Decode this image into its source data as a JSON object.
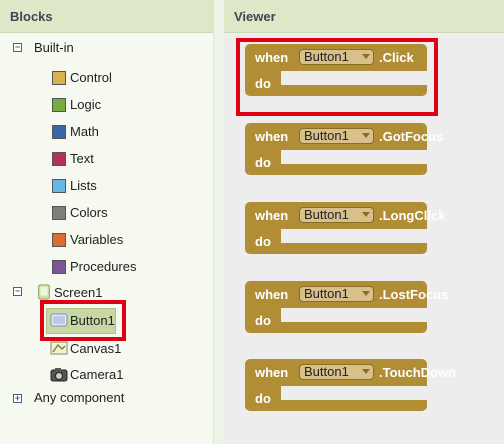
{
  "blocks_panel": {
    "title": "Blocks"
  },
  "viewer_panel": {
    "title": "Viewer"
  },
  "tree": {
    "builtin": {
      "label": "Built-in",
      "expander": "⊟",
      "items": [
        {
          "label": "Control",
          "color": "#d9b34a"
        },
        {
          "label": "Logic",
          "color": "#77ab41"
        },
        {
          "label": "Math",
          "color": "#3a67a8"
        },
        {
          "label": "Text",
          "color": "#b8305a"
        },
        {
          "label": "Lists",
          "color": "#67b7e3"
        },
        {
          "label": "Colors",
          "color": "#7d7d7d"
        },
        {
          "label": "Variables",
          "color": "#e06a2e"
        },
        {
          "label": "Procedures",
          "color": "#7b5595"
        }
      ]
    },
    "screen": {
      "label": "Screen1",
      "expander": "⊟"
    },
    "components": [
      {
        "label": "Button1",
        "icon": "button-icon"
      },
      {
        "label": "Canvas1",
        "icon": "canvas-icon"
      },
      {
        "label": "Camera1",
        "icon": "camera-icon"
      }
    ],
    "any_component": {
      "label": "Any component",
      "expander": "⊞"
    }
  },
  "event_blocks": [
    {
      "when": "when",
      "component": "Button1",
      "event": ".Click",
      "do": "do"
    },
    {
      "when": "when",
      "component": "Button1",
      "event": ".GotFocus",
      "do": "do"
    },
    {
      "when": "when",
      "component": "Button1",
      "event": ".LongClick",
      "do": "do"
    },
    {
      "when": "when",
      "component": "Button1",
      "event": ".LostFocus",
      "do": "do"
    },
    {
      "when": "when",
      "component": "Button1",
      "event": ".TouchDown",
      "do": "do"
    }
  ],
  "colors": {
    "block": "#b18e35",
    "highlight": "#e00014"
  }
}
